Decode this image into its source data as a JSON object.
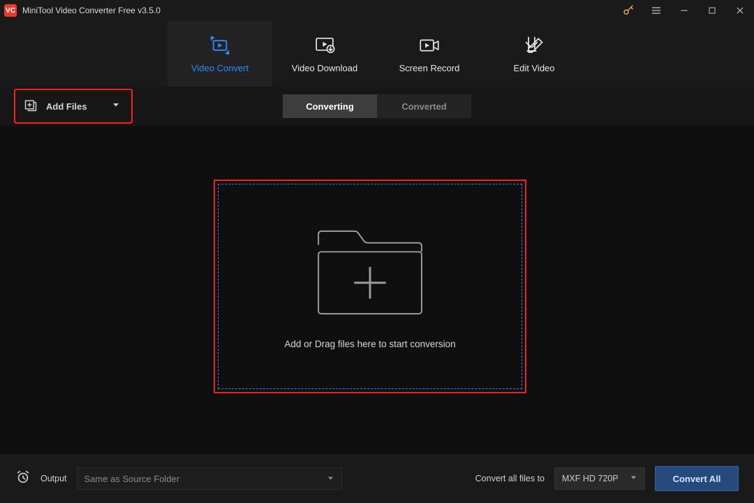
{
  "app_title": "MiniTool Video Converter Free v3.5.0",
  "logo_text": "VC",
  "nav": {
    "items": [
      {
        "label": "Video Convert"
      },
      {
        "label": "Video Download"
      },
      {
        "label": "Screen Record"
      },
      {
        "label": "Edit Video"
      }
    ]
  },
  "toolbar": {
    "add_files": "Add Files",
    "tabs": {
      "converting": "Converting",
      "converted": "Converted"
    }
  },
  "drop": {
    "hint": "Add or Drag files here to start conversion"
  },
  "footer": {
    "output_label": "Output",
    "output_value": "Same as Source Folder",
    "convert_all_to_label": "Convert all files to",
    "format_value": "MXF HD 720P",
    "convert_all_btn": "Convert All"
  },
  "colors": {
    "accent": "#2d8cff",
    "highlight": "#ff1f1f",
    "convert_all": "#274a7d"
  }
}
